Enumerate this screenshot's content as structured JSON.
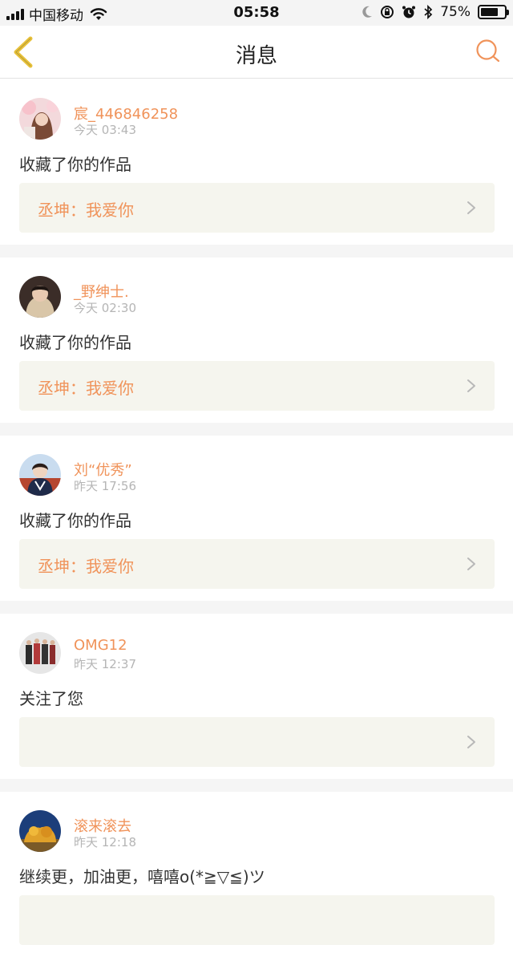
{
  "status_bar": {
    "carrier": "中国移动",
    "time": "05:58",
    "battery_percent": "75%",
    "battery_level": 0.75,
    "icons": [
      "signal-icon",
      "wifi-icon",
      "moon-icon",
      "rotation-lock-icon",
      "alarm-icon",
      "bluetooth-icon",
      "battery-icon"
    ]
  },
  "nav": {
    "title": "消息",
    "back_icon": "chevron-left-icon",
    "search_icon": "search-icon"
  },
  "colors": {
    "accent": "#f0935a",
    "back_arrow": "#e8c13a",
    "work_box_bg": "#f5f5ee",
    "separator": "#f5f5f5"
  },
  "messages": [
    {
      "username": "宸_446846258",
      "time": "今天 03:43",
      "action": "收藏了你的作品",
      "work_title": "丞坤：我爱你"
    },
    {
      "username": "_野绅士.",
      "time": "今天 02:30",
      "action": "收藏了你的作品",
      "work_title": "丞坤：我爱你"
    },
    {
      "username": "刘“优秀”",
      "time": "昨天 17:56",
      "action": "收藏了你的作品",
      "work_title": "丞坤：我爱你"
    },
    {
      "username": "OMG12",
      "time": "昨天 12:37",
      "action": "关注了您",
      "work_title": ""
    },
    {
      "username": "滚来滚去",
      "time": "昨天 12:18",
      "action": "继续更，加油更，嘻嘻o(*≧▽≦)ツ",
      "work_title": ""
    }
  ]
}
